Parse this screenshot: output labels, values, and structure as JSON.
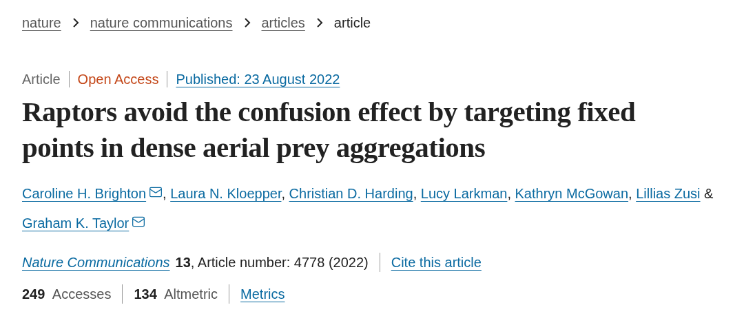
{
  "breadcrumbs": [
    {
      "label": "nature",
      "current": false
    },
    {
      "label": "nature communications",
      "current": false
    },
    {
      "label": "articles",
      "current": false
    },
    {
      "label": "article",
      "current": true
    }
  ],
  "meta": {
    "type": "Article",
    "access": "Open Access",
    "published": "Published: 23 August 2022"
  },
  "title": "Raptors avoid the confusion effect by targeting fixed points in dense aerial prey aggregations",
  "authors": [
    {
      "name": "Caroline H. Brighton",
      "email": true,
      "separator": ","
    },
    {
      "name": "Laura N. Kloepper",
      "email": false,
      "separator": ","
    },
    {
      "name": "Christian D. Harding",
      "email": false,
      "separator": ","
    },
    {
      "name": "Lucy Larkman",
      "email": false,
      "separator": ","
    },
    {
      "name": "Kathryn McGowan",
      "email": false,
      "separator": ","
    },
    {
      "name": "Lillias Zusi",
      "email": false,
      "separator": "&"
    },
    {
      "name": "Graham K. Taylor",
      "email": true
    }
  ],
  "citation": {
    "journal": "Nature Communications",
    "volume": "13",
    "details": ", Article number: 4778 (2022)",
    "cite": "Cite this article"
  },
  "metrics": [
    {
      "kind": "count",
      "label": "**249** Accesses"
    },
    {
      "kind": "count",
      "label": "**134** Altmetric"
    },
    {
      "kind": "link",
      "label": "Metrics"
    }
  ]
}
